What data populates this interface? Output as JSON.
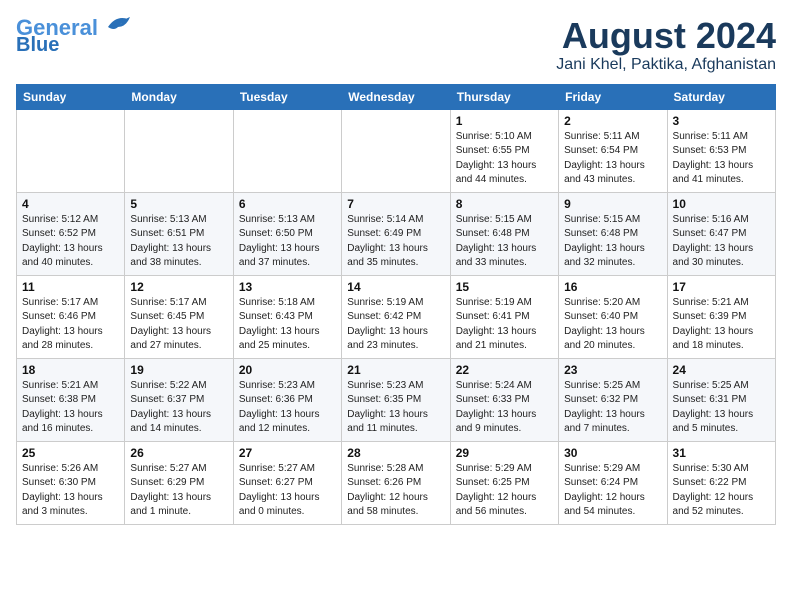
{
  "header": {
    "logo_line1": "General",
    "logo_line2": "Blue",
    "month_year": "August 2024",
    "location": "Jani Khel, Paktika, Afghanistan"
  },
  "weekdays": [
    "Sunday",
    "Monday",
    "Tuesday",
    "Wednesday",
    "Thursday",
    "Friday",
    "Saturday"
  ],
  "weeks": [
    [
      {
        "day": "",
        "info": ""
      },
      {
        "day": "",
        "info": ""
      },
      {
        "day": "",
        "info": ""
      },
      {
        "day": "",
        "info": ""
      },
      {
        "day": "1",
        "info": "Sunrise: 5:10 AM\nSunset: 6:55 PM\nDaylight: 13 hours\nand 44 minutes."
      },
      {
        "day": "2",
        "info": "Sunrise: 5:11 AM\nSunset: 6:54 PM\nDaylight: 13 hours\nand 43 minutes."
      },
      {
        "day": "3",
        "info": "Sunrise: 5:11 AM\nSunset: 6:53 PM\nDaylight: 13 hours\nand 41 minutes."
      }
    ],
    [
      {
        "day": "4",
        "info": "Sunrise: 5:12 AM\nSunset: 6:52 PM\nDaylight: 13 hours\nand 40 minutes."
      },
      {
        "day": "5",
        "info": "Sunrise: 5:13 AM\nSunset: 6:51 PM\nDaylight: 13 hours\nand 38 minutes."
      },
      {
        "day": "6",
        "info": "Sunrise: 5:13 AM\nSunset: 6:50 PM\nDaylight: 13 hours\nand 37 minutes."
      },
      {
        "day": "7",
        "info": "Sunrise: 5:14 AM\nSunset: 6:49 PM\nDaylight: 13 hours\nand 35 minutes."
      },
      {
        "day": "8",
        "info": "Sunrise: 5:15 AM\nSunset: 6:48 PM\nDaylight: 13 hours\nand 33 minutes."
      },
      {
        "day": "9",
        "info": "Sunrise: 5:15 AM\nSunset: 6:48 PM\nDaylight: 13 hours\nand 32 minutes."
      },
      {
        "day": "10",
        "info": "Sunrise: 5:16 AM\nSunset: 6:47 PM\nDaylight: 13 hours\nand 30 minutes."
      }
    ],
    [
      {
        "day": "11",
        "info": "Sunrise: 5:17 AM\nSunset: 6:46 PM\nDaylight: 13 hours\nand 28 minutes."
      },
      {
        "day": "12",
        "info": "Sunrise: 5:17 AM\nSunset: 6:45 PM\nDaylight: 13 hours\nand 27 minutes."
      },
      {
        "day": "13",
        "info": "Sunrise: 5:18 AM\nSunset: 6:43 PM\nDaylight: 13 hours\nand 25 minutes."
      },
      {
        "day": "14",
        "info": "Sunrise: 5:19 AM\nSunset: 6:42 PM\nDaylight: 13 hours\nand 23 minutes."
      },
      {
        "day": "15",
        "info": "Sunrise: 5:19 AM\nSunset: 6:41 PM\nDaylight: 13 hours\nand 21 minutes."
      },
      {
        "day": "16",
        "info": "Sunrise: 5:20 AM\nSunset: 6:40 PM\nDaylight: 13 hours\nand 20 minutes."
      },
      {
        "day": "17",
        "info": "Sunrise: 5:21 AM\nSunset: 6:39 PM\nDaylight: 13 hours\nand 18 minutes."
      }
    ],
    [
      {
        "day": "18",
        "info": "Sunrise: 5:21 AM\nSunset: 6:38 PM\nDaylight: 13 hours\nand 16 minutes."
      },
      {
        "day": "19",
        "info": "Sunrise: 5:22 AM\nSunset: 6:37 PM\nDaylight: 13 hours\nand 14 minutes."
      },
      {
        "day": "20",
        "info": "Sunrise: 5:23 AM\nSunset: 6:36 PM\nDaylight: 13 hours\nand 12 minutes."
      },
      {
        "day": "21",
        "info": "Sunrise: 5:23 AM\nSunset: 6:35 PM\nDaylight: 13 hours\nand 11 minutes."
      },
      {
        "day": "22",
        "info": "Sunrise: 5:24 AM\nSunset: 6:33 PM\nDaylight: 13 hours\nand 9 minutes."
      },
      {
        "day": "23",
        "info": "Sunrise: 5:25 AM\nSunset: 6:32 PM\nDaylight: 13 hours\nand 7 minutes."
      },
      {
        "day": "24",
        "info": "Sunrise: 5:25 AM\nSunset: 6:31 PM\nDaylight: 13 hours\nand 5 minutes."
      }
    ],
    [
      {
        "day": "25",
        "info": "Sunrise: 5:26 AM\nSunset: 6:30 PM\nDaylight: 13 hours\nand 3 minutes."
      },
      {
        "day": "26",
        "info": "Sunrise: 5:27 AM\nSunset: 6:29 PM\nDaylight: 13 hours\nand 1 minute."
      },
      {
        "day": "27",
        "info": "Sunrise: 5:27 AM\nSunset: 6:27 PM\nDaylight: 13 hours\nand 0 minutes."
      },
      {
        "day": "28",
        "info": "Sunrise: 5:28 AM\nSunset: 6:26 PM\nDaylight: 12 hours\nand 58 minutes."
      },
      {
        "day": "29",
        "info": "Sunrise: 5:29 AM\nSunset: 6:25 PM\nDaylight: 12 hours\nand 56 minutes."
      },
      {
        "day": "30",
        "info": "Sunrise: 5:29 AM\nSunset: 6:24 PM\nDaylight: 12 hours\nand 54 minutes."
      },
      {
        "day": "31",
        "info": "Sunrise: 5:30 AM\nSunset: 6:22 PM\nDaylight: 12 hours\nand 52 minutes."
      }
    ]
  ]
}
